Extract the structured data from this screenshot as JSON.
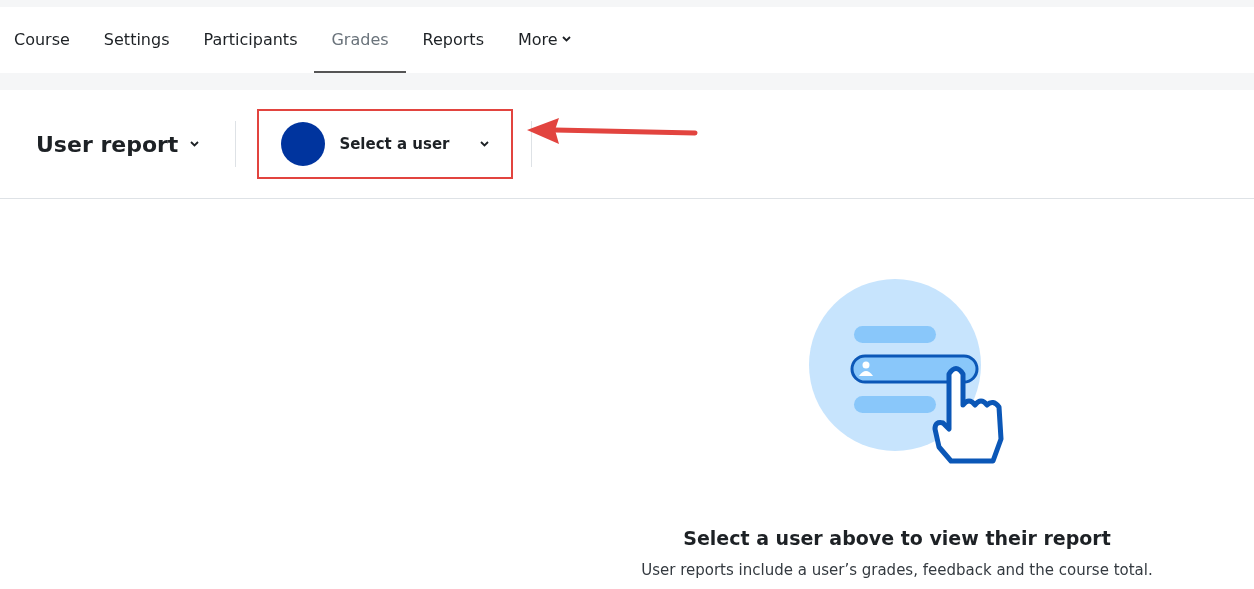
{
  "tabs": [
    {
      "label": "Course",
      "selected": false,
      "has_menu": false
    },
    {
      "label": "Settings",
      "selected": false,
      "has_menu": false
    },
    {
      "label": "Participants",
      "selected": false,
      "has_menu": false
    },
    {
      "label": "Grades",
      "selected": true,
      "has_menu": false
    },
    {
      "label": "Reports",
      "selected": false,
      "has_menu": false
    },
    {
      "label": "More",
      "selected": false,
      "has_menu": true
    }
  ],
  "report_selector": {
    "label": "User report"
  },
  "user_selector": {
    "label": "Select a user",
    "highlighted": true
  },
  "empty_state": {
    "title": "Select a user above to view their report",
    "description": "User reports include a user’s grades, feedback and the course total."
  }
}
